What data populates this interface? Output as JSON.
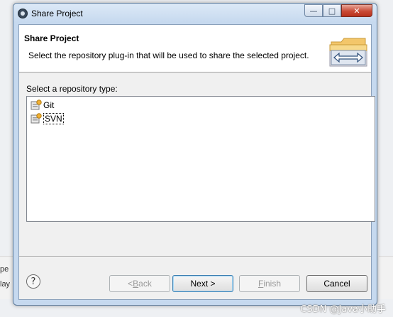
{
  "background_text": {
    "line1": "pe",
    "line2": "lay"
  },
  "window": {
    "title": "Share Project",
    "minimize_glyph": "—",
    "maximize_glyph": "□",
    "close_glyph": "✕"
  },
  "header": {
    "title": "Share Project",
    "description": "Select the repository plug-in that will be used to share the selected project."
  },
  "repository": {
    "label": "Select a repository type:",
    "items": [
      {
        "label": "Git",
        "selected": false
      },
      {
        "label": "SVN",
        "selected": true
      }
    ]
  },
  "buttons": {
    "help": "?",
    "back_prefix": "< ",
    "back_ul": "B",
    "back_rest": "ack",
    "next": "Next >",
    "finish_ul": "F",
    "finish_rest": "inish",
    "cancel": "Cancel"
  },
  "watermark": "CSDN @Java小助手",
  "colors": {
    "accent": "#3c7fb1",
    "close": "#c94a36"
  }
}
